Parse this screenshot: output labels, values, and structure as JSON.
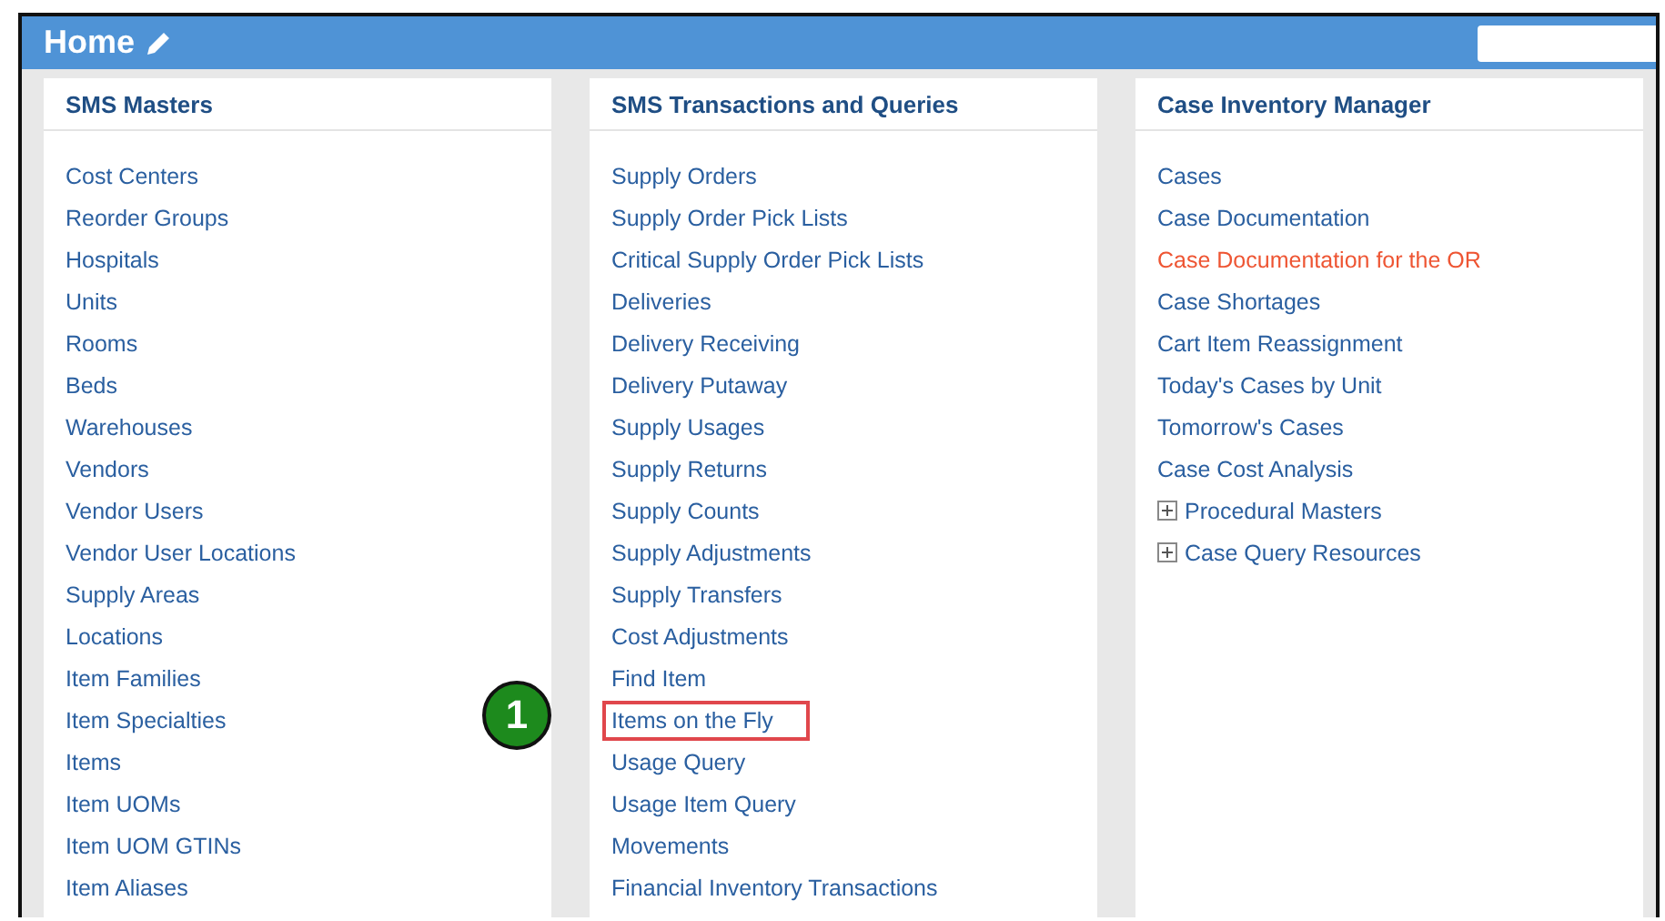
{
  "header": {
    "title": "Home"
  },
  "panels": [
    {
      "title": "SMS Masters",
      "items": [
        {
          "label": "Cost Centers"
        },
        {
          "label": "Reorder Groups"
        },
        {
          "label": "Hospitals"
        },
        {
          "label": "Units"
        },
        {
          "label": "Rooms"
        },
        {
          "label": "Beds"
        },
        {
          "label": "Warehouses"
        },
        {
          "label": "Vendors"
        },
        {
          "label": "Vendor Users"
        },
        {
          "label": "Vendor User Locations"
        },
        {
          "label": "Supply Areas"
        },
        {
          "label": "Locations"
        },
        {
          "label": "Item Families"
        },
        {
          "label": "Item Specialties"
        },
        {
          "label": "Items"
        },
        {
          "label": "Item UOMs"
        },
        {
          "label": "Item UOM GTINs"
        },
        {
          "label": "Item Aliases"
        }
      ]
    },
    {
      "title": "SMS Transactions and Queries",
      "items": [
        {
          "label": "Supply Orders"
        },
        {
          "label": "Supply Order Pick Lists"
        },
        {
          "label": "Critical Supply Order Pick Lists"
        },
        {
          "label": "Deliveries"
        },
        {
          "label": "Delivery Receiving"
        },
        {
          "label": "Delivery Putaway"
        },
        {
          "label": "Supply Usages"
        },
        {
          "label": "Supply Returns"
        },
        {
          "label": "Supply Counts"
        },
        {
          "label": "Supply Adjustments"
        },
        {
          "label": "Supply Transfers"
        },
        {
          "label": "Cost Adjustments"
        },
        {
          "label": "Find Item"
        },
        {
          "label": "Items on the Fly",
          "callout": "1"
        },
        {
          "label": "Usage Query"
        },
        {
          "label": "Usage Item Query"
        },
        {
          "label": "Movements"
        },
        {
          "label": "Financial Inventory Transactions"
        }
      ]
    },
    {
      "title": "Case Inventory Manager",
      "items": [
        {
          "label": "Cases"
        },
        {
          "label": "Case Documentation"
        },
        {
          "label": "Case Documentation for the OR",
          "highlighted": true
        },
        {
          "label": "Case Shortages"
        },
        {
          "label": "Cart Item Reassignment"
        },
        {
          "label": "Today's Cases by Unit"
        },
        {
          "label": "Tomorrow's Cases"
        },
        {
          "label": "Case Cost Analysis"
        },
        {
          "label": "Procedural Masters",
          "expanded": false
        },
        {
          "label": "Case Query Resources",
          "expanded": false
        }
      ]
    }
  ]
}
